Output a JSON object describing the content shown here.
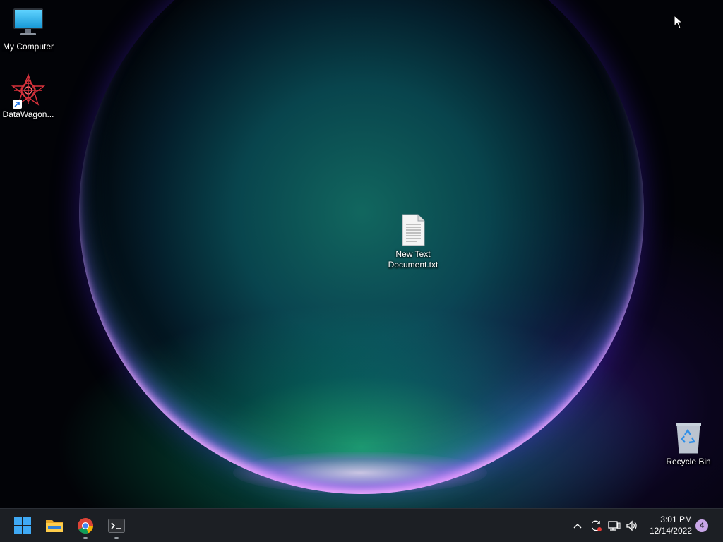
{
  "desktop": {
    "icons": [
      {
        "label": "My Computer",
        "icon": "monitor-icon"
      },
      {
        "label": "DataWagon...",
        "icon": "datawagon-shortcut-icon"
      },
      {
        "label": "New Text Document.txt",
        "icon": "text-document-icon"
      },
      {
        "label": "Recycle Bin",
        "icon": "recycle-bin-icon"
      }
    ]
  },
  "taskbar": {
    "pinned": [
      {
        "name": "Start",
        "icon": "windows-start-icon"
      },
      {
        "name": "File Explorer",
        "icon": "folder-icon"
      },
      {
        "name": "Google Chrome",
        "icon": "chrome-icon"
      },
      {
        "name": "Terminal",
        "icon": "terminal-icon"
      }
    ],
    "tray": {
      "icons": [
        "chevron-up-icon",
        "sync-icon",
        "network-icon",
        "volume-icon"
      ],
      "time": "3:01 PM",
      "date": "12/14/2022",
      "notification_count": "4"
    }
  },
  "colors": {
    "taskbar_bg": "#1c1f24",
    "accent": "#3fa9f5",
    "notification_badge": "#c9a6e8"
  }
}
